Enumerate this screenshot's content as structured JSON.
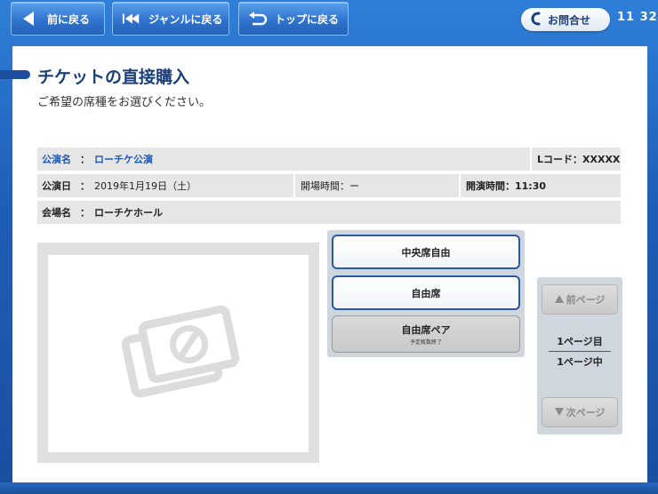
{
  "nav": {
    "back_label": "前に戻る",
    "genre_back_label": "ジャンルに戻る",
    "top_back_label": "トップに戻る",
    "inquiry_label": "お問合せ",
    "clock": "11 32"
  },
  "page": {
    "title": "チケットの直接購入",
    "subtitle": "ご希望の席種をお選びください。"
  },
  "event": {
    "name_label": "公演名",
    "colon": "：",
    "name_value": "ローチケ公演",
    "lcode": "Lコード：XXXXX",
    "date_label": "公演日",
    "date_value": "2019年1月19日（土）",
    "open_time": "開場時間：ー",
    "start_time": "開演時間：11:30",
    "venue_label": "会場名",
    "venue_value": "ローチケホール"
  },
  "seats": [
    {
      "label": "中央席自由",
      "note": ""
    },
    {
      "label": "自由席",
      "note": ""
    },
    {
      "label": "自由席ペア",
      "note": "予定枚数終了"
    }
  ],
  "pager": {
    "prev_label": "前ページ",
    "next_label": "次ページ",
    "current": "1ページ目",
    "total": "1ページ中"
  },
  "colors": {
    "accent": "#1d59b5",
    "header_bg": "#2f74cf",
    "title": "#1b3f7a"
  },
  "icons": [
    "back-arrow-icon",
    "skip-back-icon",
    "return-arrow-icon",
    "phone-icon",
    "no-image-icon",
    "up-triangle-icon",
    "down-triangle-icon"
  ]
}
